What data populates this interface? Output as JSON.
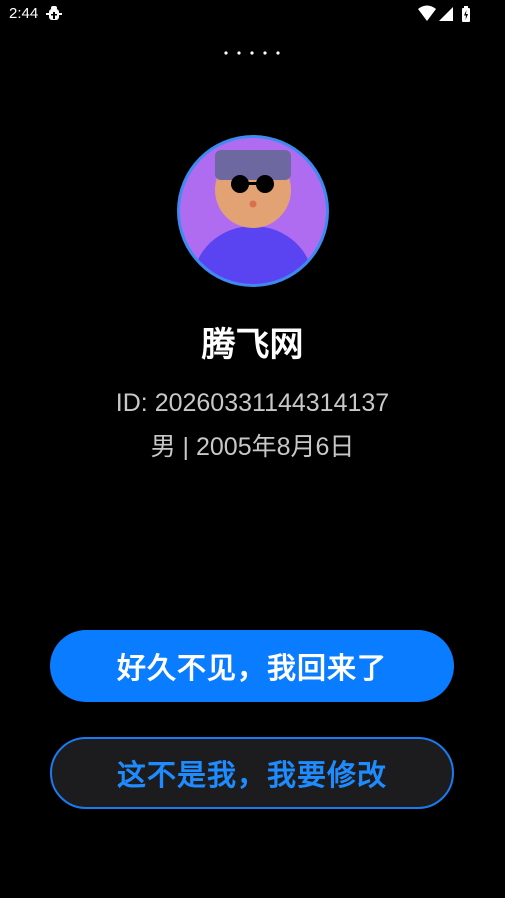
{
  "status_bar": {
    "time": "2:44",
    "icons": [
      "bug-icon",
      "wifi-icon",
      "signal-icon",
      "battery-icon"
    ]
  },
  "pager": {
    "dot_count": 5
  },
  "profile": {
    "name": "腾飞网",
    "id_text": "ID: 20260331144314137",
    "info_text": "男 | 2005年8月6日"
  },
  "actions": {
    "confirm_label": "好久不见，我回来了",
    "modify_label": "这不是我，我要修改"
  },
  "colors": {
    "background": "#000000",
    "primary": "#0a7cff",
    "secondary_border": "#1a7af0",
    "avatar_bg": "#b06cf0",
    "avatar_ring": "#3d8bf0"
  }
}
